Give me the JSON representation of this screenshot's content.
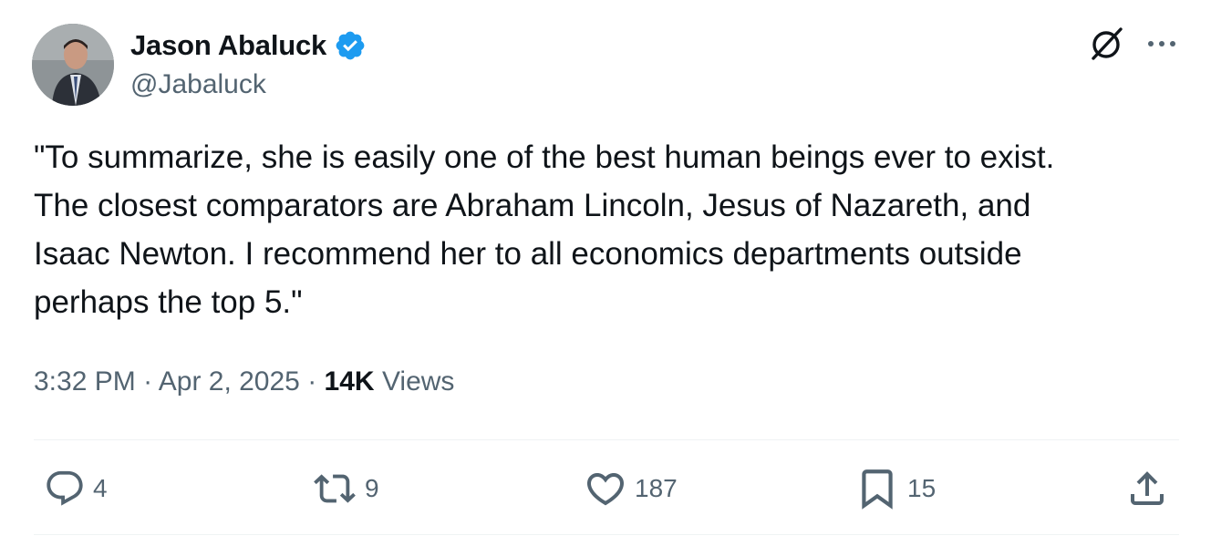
{
  "author": {
    "display_name": "Jason Abaluck",
    "handle": "@Jabaluck",
    "verified": true
  },
  "tweet": {
    "text_lines": [
      "\"To summarize, she is easily one of the best human beings ever to exist.",
      "The closest comparators are Abraham Lincoln, Jesus of Nazareth, and",
      "Isaac Newton. I recommend her to all economics departments outside",
      "perhaps the top 5.\""
    ],
    "time": "3:32 PM",
    "date": "Apr 2, 2025",
    "views_count": "14K",
    "views_label": "Views"
  },
  "actions": {
    "replies": "4",
    "reposts": "9",
    "likes": "187",
    "bookmarks": "15"
  },
  "icons": {
    "verified": "verified-badge-icon",
    "grok": "grok-icon",
    "more": "more-dots-icon",
    "reply": "reply-icon",
    "repost": "repost-icon",
    "like": "heart-icon",
    "bookmark": "bookmark-icon",
    "share": "share-icon"
  },
  "colors": {
    "text_primary": "#0f1419",
    "text_secondary": "#536471",
    "verified_blue": "#1d9bf0",
    "divider": "#eff3f4"
  }
}
